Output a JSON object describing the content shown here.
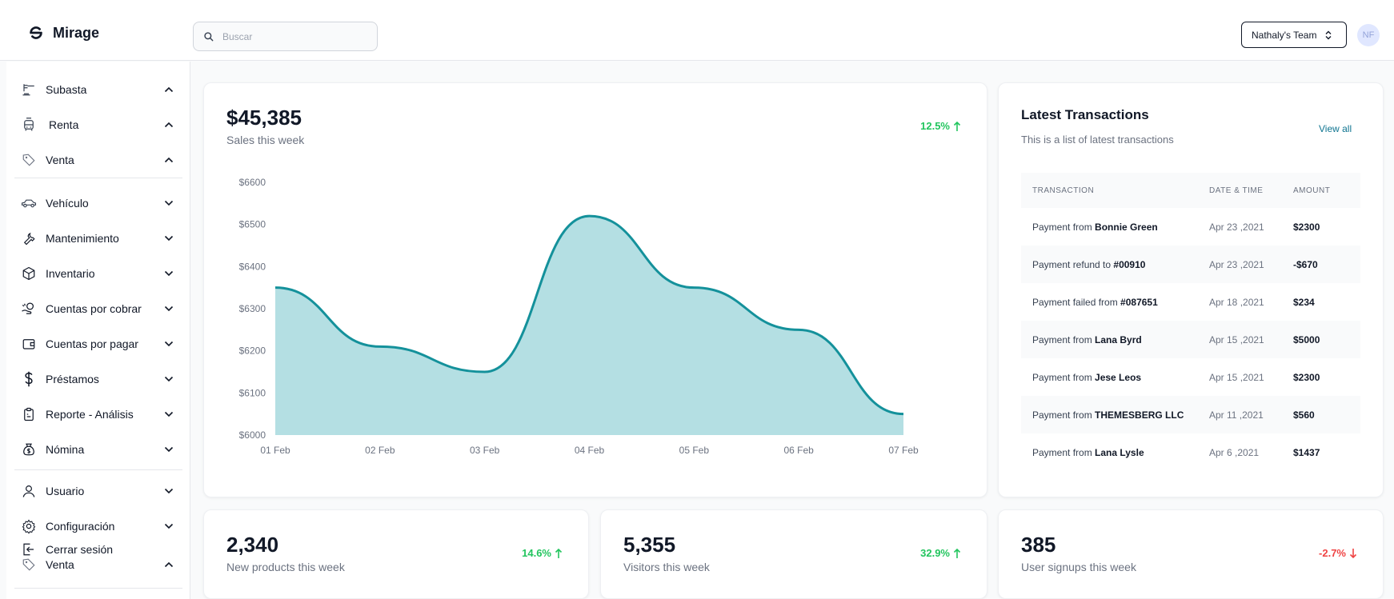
{
  "app": {
    "name": "Mirage"
  },
  "search": {
    "placeholder": "Buscar"
  },
  "team": {
    "selected": "Nathaly's Team"
  },
  "user": {
    "initials": "NF"
  },
  "sidebar": {
    "group1": [
      {
        "label": "Subasta",
        "icon": "gavel-icon",
        "chevron": "up"
      },
      {
        "label": "Renta",
        "icon": "bus-icon",
        "chevron": "up"
      },
      {
        "label": "Venta",
        "icon": "tag-icon",
        "chevron": "up"
      }
    ],
    "group2": [
      {
        "label": "Vehículo",
        "icon": "car-icon",
        "chevron": "down"
      },
      {
        "label": "Mantenimiento",
        "icon": "wrench-icon",
        "chevron": "down"
      },
      {
        "label": "Inventario",
        "icon": "box-icon",
        "chevron": "down"
      },
      {
        "label": "Cuentas por cobrar",
        "icon": "hand-coins-icon",
        "chevron": "down"
      },
      {
        "label": "Cuentas por pagar",
        "icon": "wallet-icon",
        "chevron": "down"
      },
      {
        "label": "Préstamos",
        "icon": "dollar-icon",
        "chevron": "down"
      },
      {
        "label": "Reporte - Análisis",
        "icon": "clipboard-icon",
        "chevron": "down"
      },
      {
        "label": "Nómina",
        "icon": "money-bag-icon",
        "chevron": "down"
      }
    ],
    "group3": [
      {
        "label": "Usuario",
        "icon": "user-icon",
        "chevron": "down"
      },
      {
        "label": "Configuración",
        "icon": "gear-icon",
        "chevron": "down"
      },
      {
        "label": "Cerrar sesión",
        "icon": "logout-icon"
      },
      {
        "label": "Venta",
        "icon": "tag-icon",
        "chevron": "up"
      }
    ]
  },
  "sales": {
    "value": "$45,385",
    "label": "Sales this week",
    "growth": "12.5%"
  },
  "chart_data": {
    "type": "area",
    "categories": [
      "01 Feb",
      "02 Feb",
      "03 Feb",
      "04 Feb",
      "05 Feb",
      "06 Feb",
      "07 Feb"
    ],
    "values": [
      6350,
      6210,
      6150,
      6520,
      6350,
      6250,
      6050
    ],
    "y_ticks": [
      "$6600",
      "$6500",
      "$6400",
      "$6300",
      "$6200",
      "$6100",
      "$6000"
    ],
    "ylim": [
      6000,
      6600
    ],
    "fill_color": "#b4dfe3",
    "line_color": "#14919b"
  },
  "transactions": {
    "title": "Latest Transactions",
    "subtitle": "This is a list of latest transactions",
    "view_all": "View all",
    "headers": [
      "TRANSACTION",
      "DATE & TIME",
      "AMOUNT"
    ],
    "rows": [
      {
        "prefix": "Payment from ",
        "party": "Bonnie Green",
        "date": "Apr 23 ,2021",
        "amount": "$2300"
      },
      {
        "prefix": "Payment refund to ",
        "party": "#00910",
        "date": "Apr 23 ,2021",
        "amount": "-$670"
      },
      {
        "prefix": "Payment failed from ",
        "party": "#087651",
        "date": "Apr 18 ,2021",
        "amount": "$234"
      },
      {
        "prefix": "Payment from ",
        "party": "Lana Byrd",
        "date": "Apr 15 ,2021",
        "amount": "$5000"
      },
      {
        "prefix": "Payment from ",
        "party": "Jese Leos",
        "date": "Apr 15 ,2021",
        "amount": "$2300"
      },
      {
        "prefix": "Payment from ",
        "party": "THEMESBERG LLC",
        "date": "Apr 11 ,2021",
        "amount": "$560"
      },
      {
        "prefix": "Payment from ",
        "party": "Lana Lysle",
        "date": "Apr 6 ,2021",
        "amount": "$1437"
      }
    ]
  },
  "stats": [
    {
      "value": "2,340",
      "label": "New products this week",
      "growth": "14.6%",
      "direction": "up"
    },
    {
      "value": "5,355",
      "label": "Visitors this week",
      "growth": "32.9%",
      "direction": "up"
    },
    {
      "value": "385",
      "label": "User signups this week",
      "growth": "-2.7%",
      "direction": "down"
    }
  ],
  "colors": {
    "accent": "#0e7490",
    "up": "#22c55e",
    "down": "#ef4444"
  }
}
